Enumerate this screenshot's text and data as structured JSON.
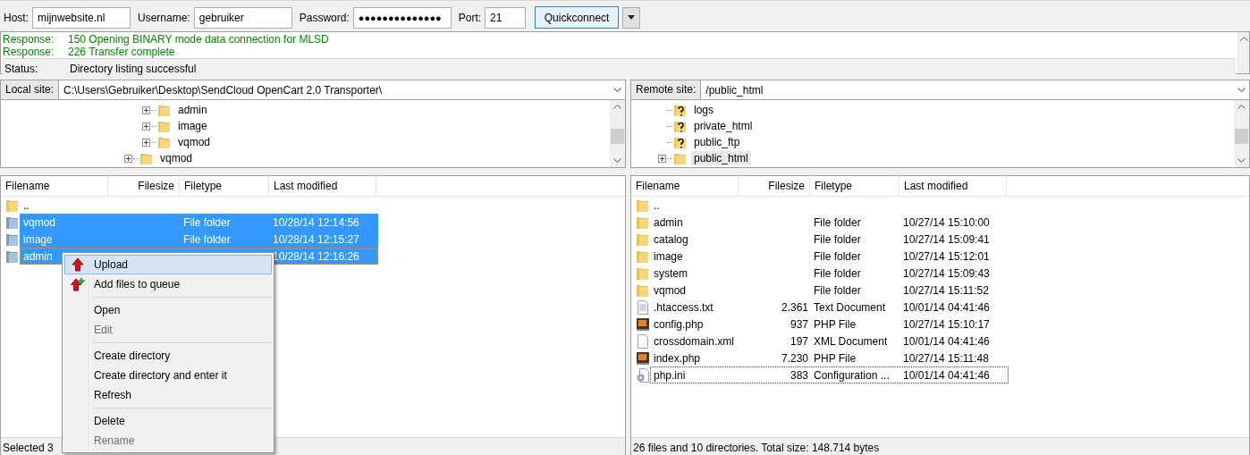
{
  "quickconnect": {
    "fields": [
      {
        "label": "Host:",
        "value": "mijnwebsite.nl",
        "kind": "text"
      },
      {
        "label": "Username:",
        "value": "gebruiker",
        "kind": "text"
      },
      {
        "label": "Password:",
        "value": "●●●●●●●●●●●●●●",
        "kind": "password"
      },
      {
        "label": "Port:",
        "value": "21",
        "kind": "port"
      }
    ],
    "button": "Quickconnect"
  },
  "log": [
    {
      "kind": "response",
      "label": "Response:",
      "text": "150 Opening BINARY mode data connection for MLSD"
    },
    {
      "kind": "response",
      "label": "Response:",
      "text": "226 Transfer complete"
    },
    {
      "kind": "status",
      "label": "Status:",
      "text": "Directory listing successful"
    }
  ],
  "local": {
    "site_label": "Local site:",
    "path": "C:\\Users\\Gebruiker\\Desktop\\SendCloud OpenCart 2.0 Transporter\\",
    "tree": [
      {
        "children": [
          {
            "label": "admin",
            "kind": "folder",
            "expandable": true,
            "selected": false
          },
          {
            "label": "image",
            "kind": "folder",
            "expandable": true,
            "selected": false
          },
          {
            "label": "vqmod",
            "kind": "folder",
            "expandable": true,
            "selected": false
          }
        ]
      },
      {
        "label": "vqmod",
        "kind": "folder",
        "expandable": true,
        "selected": false
      }
    ],
    "columns": [
      "Filename",
      "Filesize",
      "Filetype",
      "Last modified"
    ],
    "rows": [
      {
        "name": "..",
        "kind": "folder",
        "size": "",
        "type": "",
        "modified": "",
        "selected": false,
        "focused": false
      },
      {
        "name": "vqmod",
        "kind": "folder",
        "size": "",
        "type": "File folder",
        "modified": "10/28/14 12:14:56",
        "selected": true,
        "focused": false
      },
      {
        "name": "image",
        "kind": "folder",
        "size": "",
        "type": "File folder",
        "modified": "10/28/14 12:15:27",
        "selected": true,
        "focused": false
      },
      {
        "name": "admin",
        "kind": "folder",
        "size": "",
        "type": "",
        "modified": "10/28/14 12:16:26",
        "selected": true,
        "focused": true
      }
    ],
    "status": "Selected 3"
  },
  "remote": {
    "site_label": "Remote site:",
    "path": "/public_html",
    "tree": [
      {
        "label": "logs",
        "kind": "unknown",
        "expandable": false,
        "selected": false
      },
      {
        "label": "private_html",
        "kind": "unknown",
        "expandable": false,
        "selected": false
      },
      {
        "label": "public_ftp",
        "kind": "unknown",
        "expandable": false,
        "selected": false
      },
      {
        "label": "public_html",
        "kind": "folder",
        "expandable": true,
        "selected": true
      }
    ],
    "columns": [
      "Filename",
      "Filesize",
      "Filetype",
      "Last modified"
    ],
    "rows": [
      {
        "name": "..",
        "kind": "folder",
        "size": "",
        "type": "",
        "modified": "",
        "selected": false,
        "focused": false
      },
      {
        "name": "admin",
        "kind": "folder",
        "size": "",
        "type": "File folder",
        "modified": "10/27/14 15:10:00",
        "selected": false,
        "focused": false
      },
      {
        "name": "catalog",
        "kind": "folder",
        "size": "",
        "type": "File folder",
        "modified": "10/27/14 15:09:41",
        "selected": false,
        "focused": false
      },
      {
        "name": "image",
        "kind": "folder",
        "size": "",
        "type": "File folder",
        "modified": "10/27/14 15:12:01",
        "selected": false,
        "focused": false
      },
      {
        "name": "system",
        "kind": "folder",
        "size": "",
        "type": "File folder",
        "modified": "10/27/14 15:09:43",
        "selected": false,
        "focused": false
      },
      {
        "name": "vqmod",
        "kind": "folder",
        "size": "",
        "type": "File folder",
        "modified": "10/27/14 15:11:52",
        "selected": false,
        "focused": false
      },
      {
        "name": ".htaccess.txt",
        "kind": "text",
        "size": "2.361",
        "type": "Text Document",
        "modified": "10/01/14 04:41:46",
        "selected": false,
        "focused": false
      },
      {
        "name": "config.php",
        "kind": "php",
        "size": "937",
        "type": "PHP File",
        "modified": "10/27/14 15:10:17",
        "selected": false,
        "focused": false
      },
      {
        "name": "crossdomain.xml",
        "kind": "blank",
        "size": "197",
        "type": "XML Document",
        "modified": "10/01/14 04:41:46",
        "selected": false,
        "focused": false
      },
      {
        "name": "index.php",
        "kind": "php",
        "size": "7.230",
        "type": "PHP File",
        "modified": "10/27/14 15:11:48",
        "selected": false,
        "focused": false
      },
      {
        "name": "php.ini",
        "kind": "config",
        "size": "383",
        "type": "Configuration ...",
        "modified": "10/01/14 04:41:46",
        "selected": false,
        "focused": true
      }
    ],
    "status": "26 files and 10 directories. Total size: 148.714 bytes"
  },
  "context_menu": [
    {
      "kind": "item",
      "label": "Upload",
      "disabled": false,
      "selected": true
    },
    {
      "kind": "item",
      "label": "Add files to queue",
      "disabled": false,
      "selected": false
    },
    {
      "kind": "separator"
    },
    {
      "kind": "item",
      "label": "Open",
      "disabled": false,
      "selected": false
    },
    {
      "kind": "item",
      "label": "Edit",
      "disabled": true,
      "selected": false
    },
    {
      "kind": "separator"
    },
    {
      "kind": "item",
      "label": "Create directory",
      "disabled": false,
      "selected": false
    },
    {
      "kind": "item",
      "label": "Create directory and enter it",
      "disabled": false,
      "selected": false
    },
    {
      "kind": "item",
      "label": "Refresh",
      "disabled": false,
      "selected": false
    },
    {
      "kind": "separator"
    },
    {
      "kind": "item",
      "label": "Delete",
      "disabled": false,
      "selected": false
    },
    {
      "kind": "item",
      "label": "Rename",
      "disabled": true,
      "selected": false
    }
  ]
}
